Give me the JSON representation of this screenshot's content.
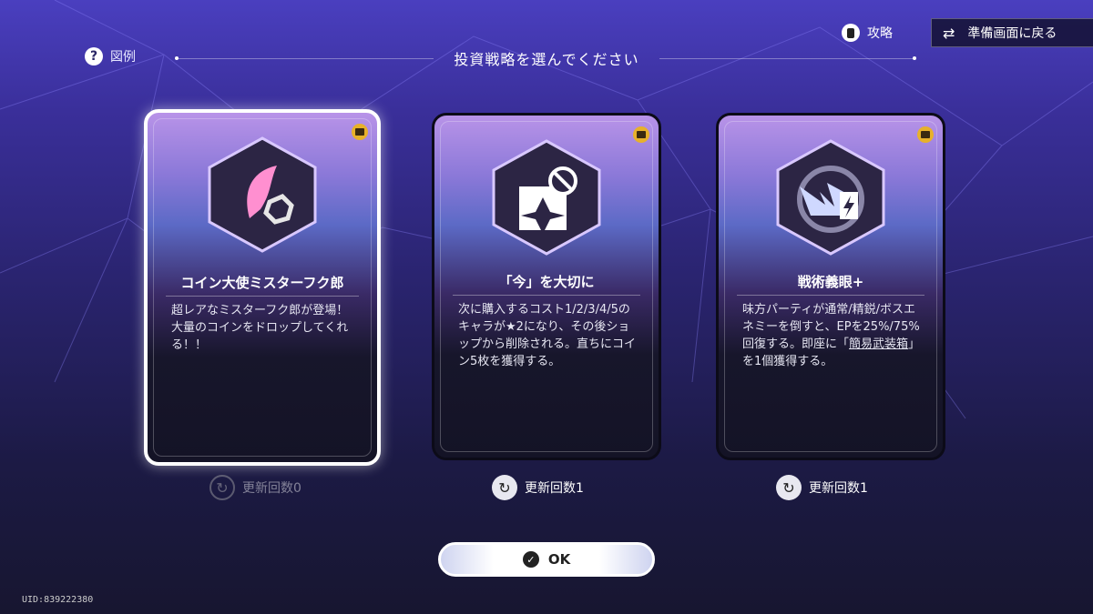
{
  "legend": {
    "icon": "question-icon",
    "label": "図例"
  },
  "title": "投資戦略を選んでください",
  "strategy": {
    "label": "攻略"
  },
  "back_button": {
    "label": "準備画面に戻る"
  },
  "cards": [
    {
      "title": "コイン大使ミスターフク郎",
      "desc": "超レアなミスターフク郎が登場！大量のコインをドロップしてくれる！！",
      "refresh": "更新回数0",
      "selected": true
    },
    {
      "title": "「今」を大切に",
      "desc": "次に購入するコスト1/2/3/4/5のキャラが★2になり、その後ショップから削除される。直ちにコイン5枚を獲得する。",
      "refresh": "更新回数1",
      "selected": false
    },
    {
      "title": "戦術義眼+",
      "desc_pre": "味方パーティが通常/精鋭/ボスエネミーを倒すと、EPを25%/75%回復する。即座に「",
      "desc_link": "簡易武装箱",
      "desc_post": "」を1個獲得する。",
      "refresh": "更新回数1",
      "selected": false
    }
  ],
  "ok_button": {
    "label": "OK"
  },
  "uid": "UID:839222380",
  "colors": {
    "accent": "#e7b12b",
    "bg_top": "#4a3fbf",
    "bg_bottom": "#171630"
  }
}
